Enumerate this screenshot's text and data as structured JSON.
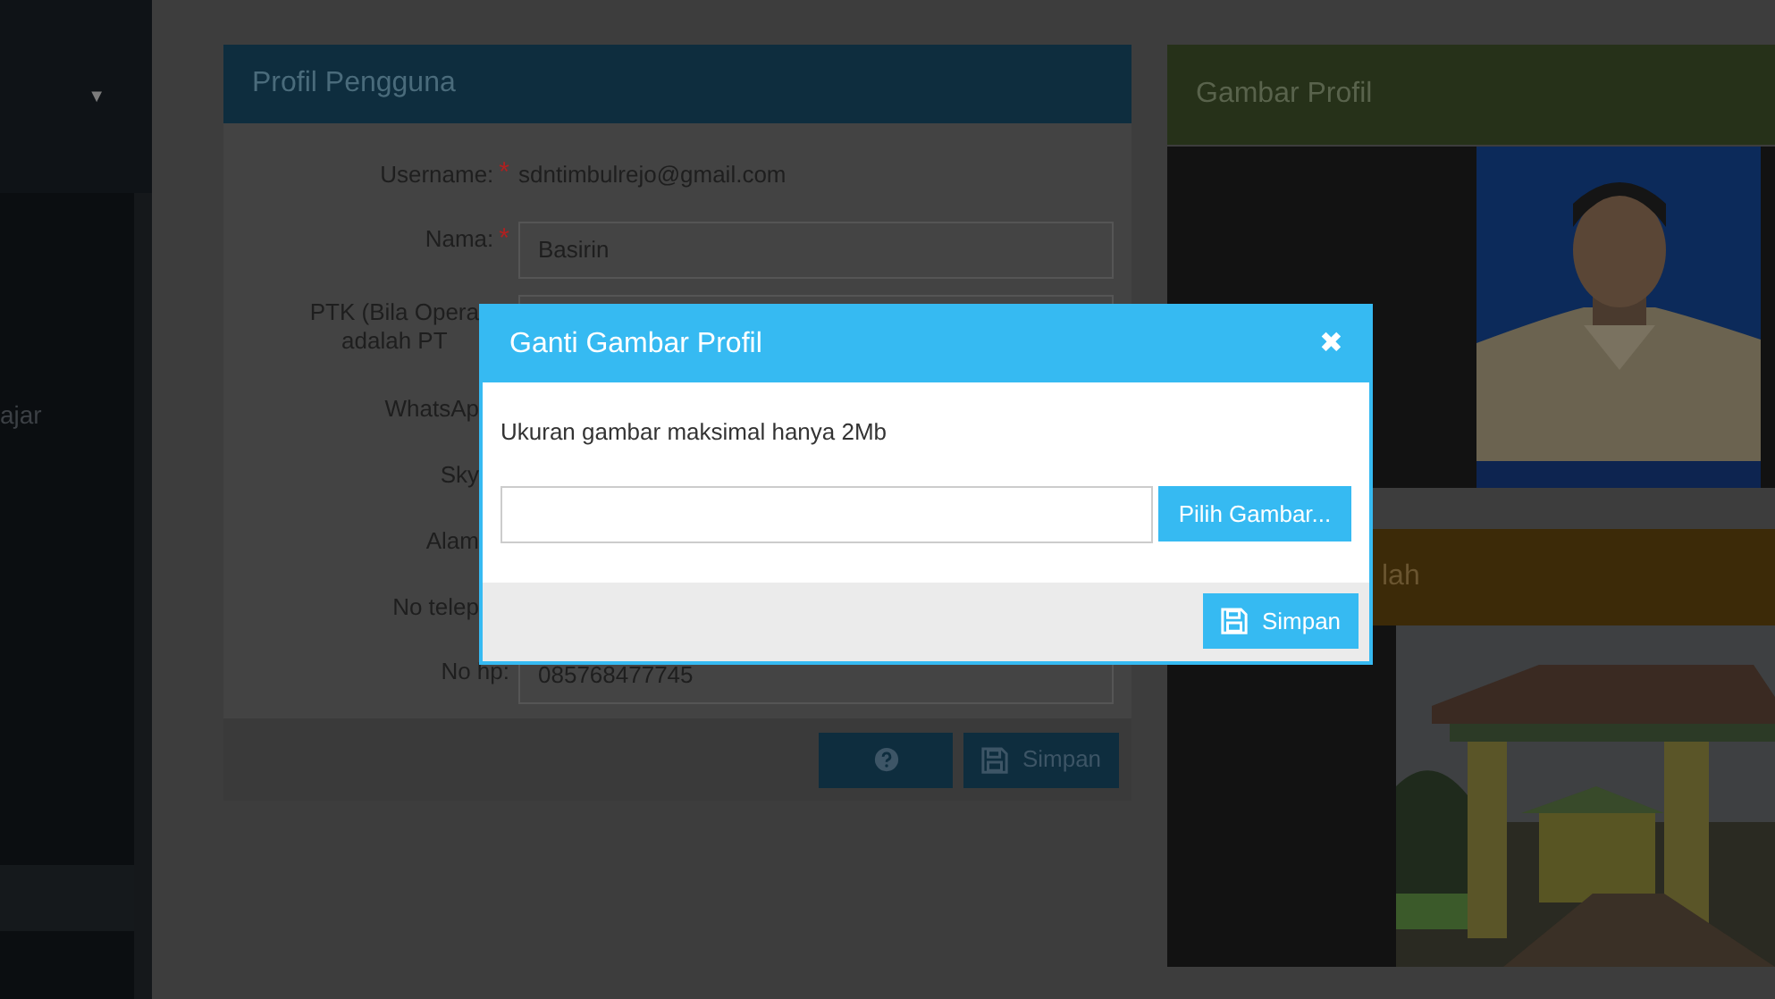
{
  "sidebar": {
    "dropdown_caret": "▼",
    "items": [
      {
        "label": "ajar",
        "selected": false
      },
      {
        "selected": true
      }
    ]
  },
  "profile_form": {
    "title": "Profil Pengguna",
    "rows": [
      {
        "kind": "text",
        "label": [
          "Username:"
        ],
        "required_mark": "*",
        "value": "sdntimbulrejo@gmail.com"
      },
      {
        "kind": "input",
        "label": [
          "Nama:"
        ],
        "required_mark": "*",
        "value": "Basirin"
      },
      {
        "kind": "input",
        "label": [
          "PTK (Bila Opera",
          "adalah PT"
        ]
      },
      {
        "kind": "hidden",
        "label": [
          "WhatsAp"
        ]
      },
      {
        "kind": "hidden",
        "label": [
          "Sky"
        ]
      },
      {
        "kind": "hidden",
        "label": [
          "Alam"
        ]
      },
      {
        "kind": "hidden",
        "label": [
          "No telep"
        ]
      },
      {
        "kind": "input",
        "label": [
          "No hp:"
        ],
        "value": "085768477745"
      }
    ],
    "buttons": [
      {
        "kind": "help"
      },
      {
        "kind": "save",
        "label": "Simpan"
      }
    ]
  },
  "profile_picture_card": {
    "title": "Gambar Profil"
  },
  "school_picture_card": {
    "title": "lah"
  },
  "dialog": {
    "title": "Ganti Gambar Profil",
    "close": "✖",
    "message": "Ukuran gambar maksimal hanya 2Mb",
    "file_button": "Pilih Gambar...",
    "save_button": "Simpan"
  }
}
